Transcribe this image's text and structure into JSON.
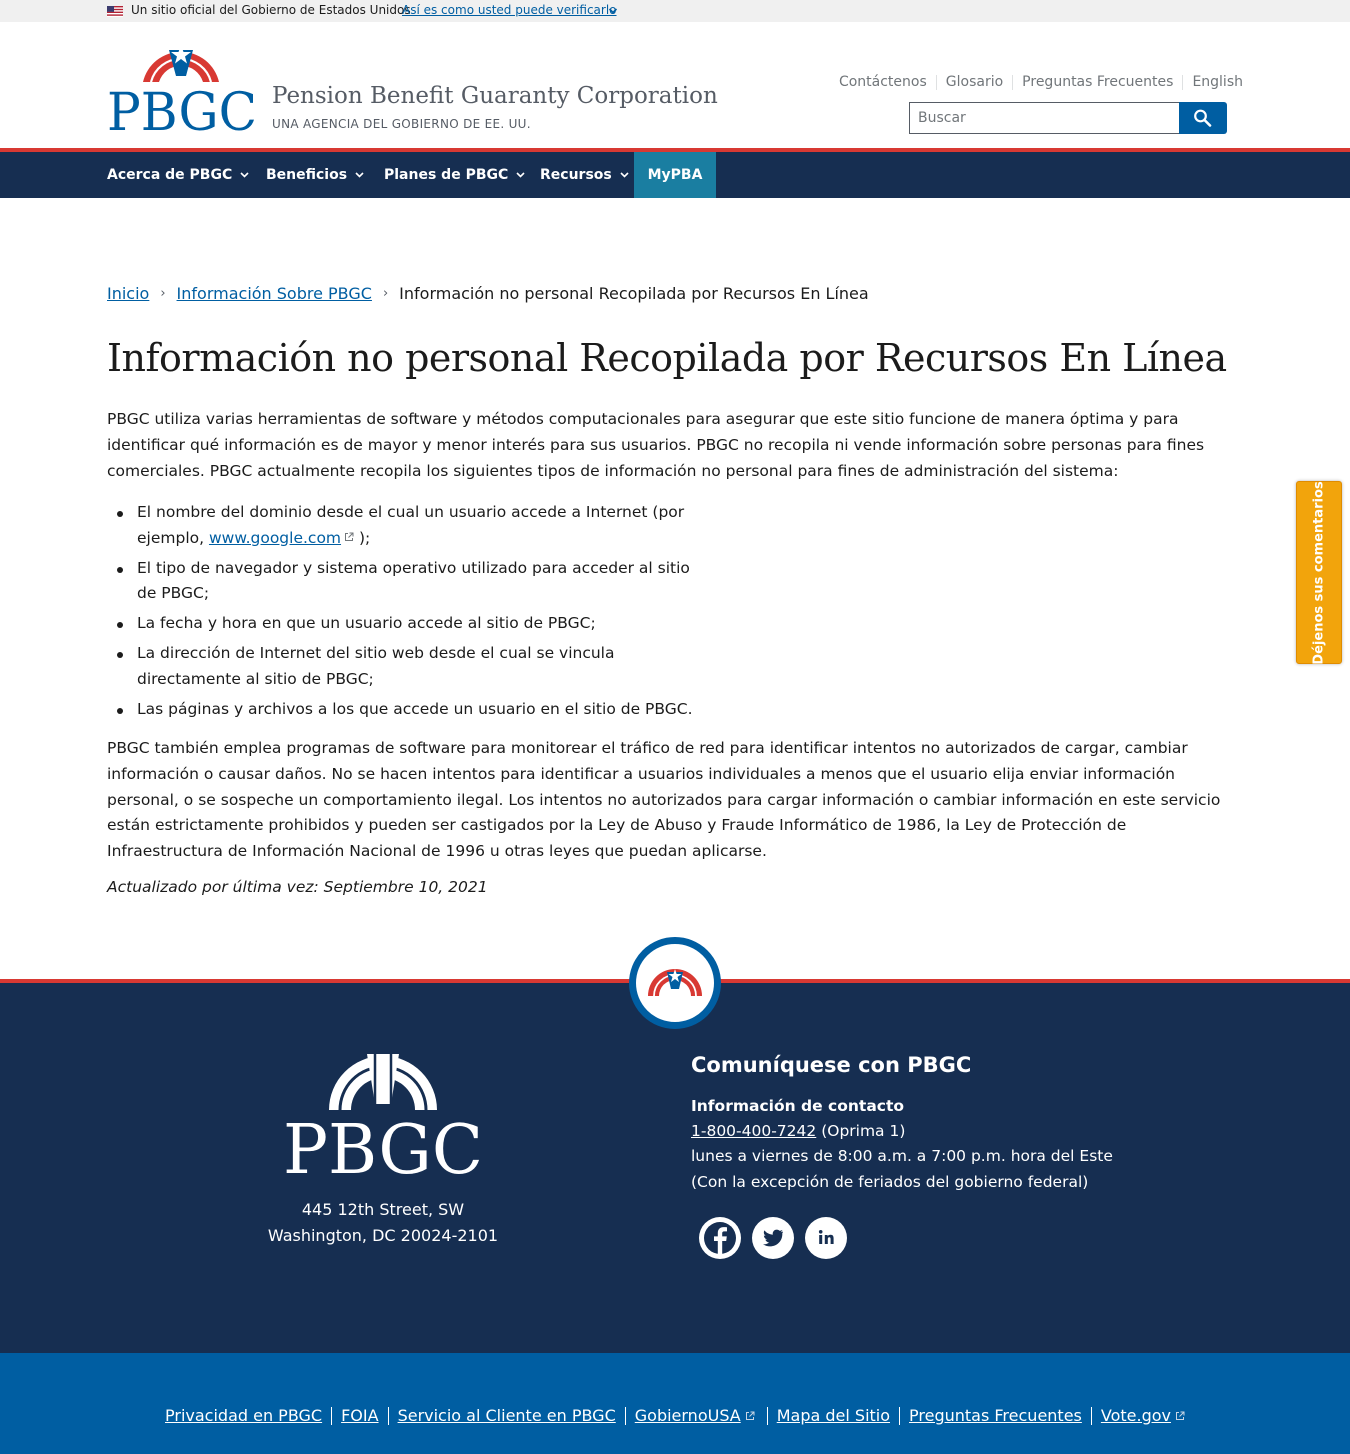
{
  "gov_banner": {
    "official_text": "Un sitio oficial del Gobierno de Estados Unidos",
    "verify_link": "Así es como usted puede verificarlo"
  },
  "header": {
    "logo_text": "PBGC",
    "site_name": "Pension Benefit Guaranty Corporation",
    "site_subtitle": "UNA AGENCIA DEL GOBIERNO DE EE. UU.",
    "utility_links": [
      "Contáctenos",
      "Glosario",
      "Preguntas Frecuentes",
      "English"
    ],
    "search": {
      "placeholder": "Buscar",
      "value": ""
    }
  },
  "nav": {
    "items": [
      "Acerca de PBGC",
      "Beneficios",
      "Planes de PBGC",
      "Recursos",
      "MyPBA"
    ]
  },
  "breadcrumb": {
    "items": [
      "Inicio",
      "Información Sobre PBGC"
    ],
    "current": "Información no personal Recopilada por Recursos En Línea"
  },
  "page": {
    "title": "Información no personal Recopilada por Recursos En Línea",
    "intro": "PBGC utiliza varias herramientas de software y métodos computacionales para asegurar que este sitio funcione de manera óptima y para identificar qué información es de mayor y menor interés para sus usuarios. PBGC no recopila ni vende información sobre personas para fines comerciales. PBGC actualmente recopila los siguientes tipos de información no personal para fines de administración del sistema:",
    "list": {
      "item1_before": "El nombre del dominio desde el cual un usuario accede a Internet (por ejemplo, ",
      "item1_link": "www.google.com",
      "item1_after": " );",
      "item2": "El tipo de navegador y sistema operativo utilizado para acceder al sitio de PBGC;",
      "item3": "La fecha y hora en que un usuario accede al sitio de PBGC;",
      "item4": "La dirección de Internet del sitio web desde el cual se vincula directamente al sitio de PBGC;",
      "item5": "Las páginas y archivos a los que accede un usuario en el sitio de PBGC."
    },
    "paragraph2": "PBGC también emplea programas de software para monitorear el tráfico de red para identificar intentos no autorizados de cargar, cambiar información o causar daños. No se hacen intentos para identificar a usuarios individuales a menos que el usuario elija enviar información personal, o se sospeche un comportamiento ilegal. Los intentos no autorizados para cargar información o cambiar información en este servicio están estrictamente prohibidos y pueden ser castigados por la Ley de Abuso y Fraude Informático de 1986, la Ley de Protección de Infraestructura de Información Nacional de 1996 u otras leyes que puedan aplicarse.",
    "updated": "Actualizado por última vez: Septiembre 10, 2021"
  },
  "feedback_tab": "Déjenos sus comentarios",
  "footer": {
    "logo_text": "PBGC",
    "address_line1": "445 12th Street, SW",
    "address_line2": "Washington, DC 20024-2101",
    "contact_heading": "Comuníquese con PBGC",
    "contact_subheading": "Información de contacto",
    "phone": "1-800-400-7242",
    "phone_note": " (Oprima 1)",
    "hours": "lunes a viernes de 8:00 a.m. a 7:00 p.m. hora del Este",
    "holidays": "(Con la excepción de feriados del gobierno federal)",
    "social": [
      "facebook-icon",
      "twitter-icon",
      "linkedin-icon"
    ]
  },
  "subfooter": {
    "links": [
      "Privacidad en PBGC",
      "FOIA",
      "Servicio al Cliente en PBGC",
      "GobiernoUSA",
      "Mapa del Sitio",
      "Preguntas Frecuentes",
      "Vote.gov"
    ]
  },
  "colors": {
    "navy": "#162e51",
    "primary_blue": "#005ea2",
    "red": "#d83933",
    "mypba_teal": "#1a7ea1",
    "feedback_orange": "#f2a40c"
  }
}
